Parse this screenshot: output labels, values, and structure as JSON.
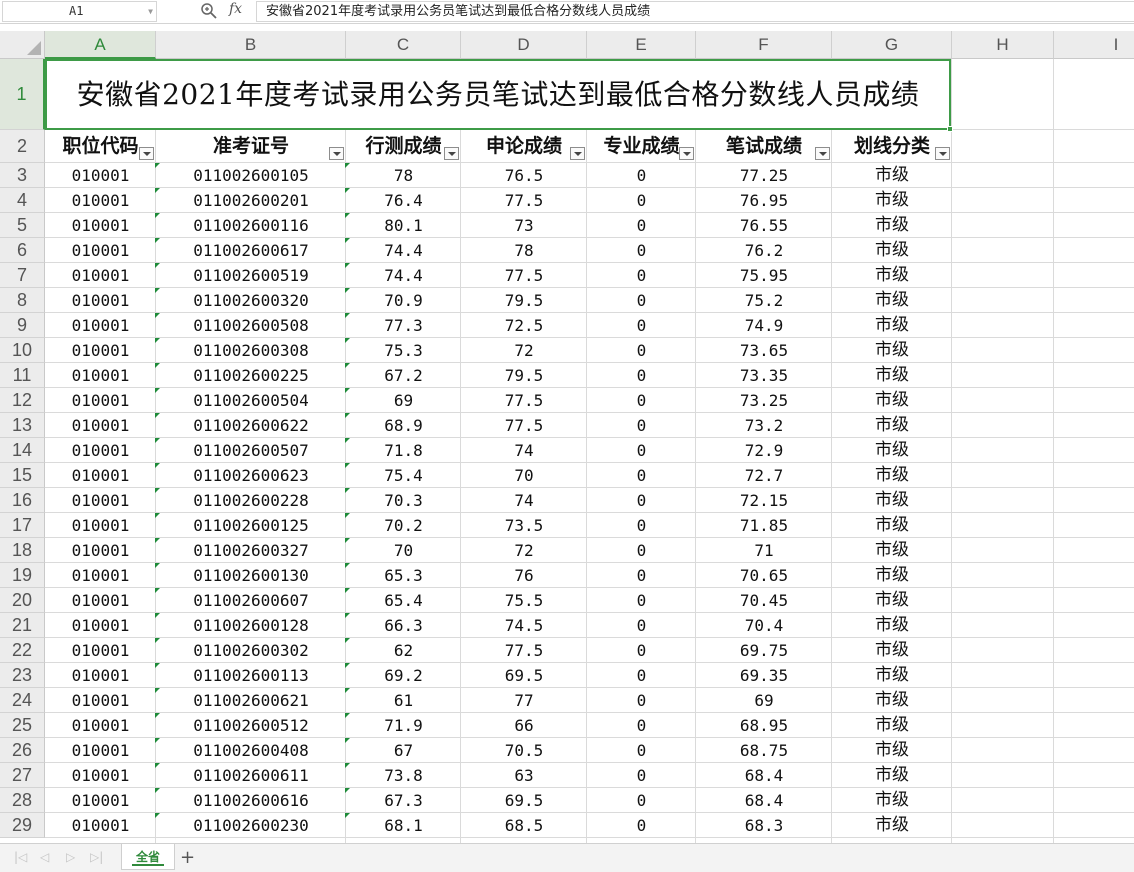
{
  "formula_bar": {
    "cell_ref": "A1",
    "fx_label": "fx",
    "formula": "安徽省2021年度考试录用公务员笔试达到最低合格分数线人员成绩"
  },
  "columns": [
    "A",
    "B",
    "C",
    "D",
    "E",
    "F",
    "G",
    "H",
    "I"
  ],
  "selected_column": "A",
  "selected_row": 1,
  "title": "安徽省2021年度考试录用公务员笔试达到最低合格分数线人员成绩",
  "headers": [
    "职位代码",
    "准考证号",
    "行测成绩",
    "申论成绩",
    "专业成绩",
    "笔试成绩",
    "划线分类"
  ],
  "rows": [
    [
      "010001",
      "011002600105",
      "78",
      "76.5",
      "0",
      "77.25",
      "市级"
    ],
    [
      "010001",
      "011002600201",
      "76.4",
      "77.5",
      "0",
      "76.95",
      "市级"
    ],
    [
      "010001",
      "011002600116",
      "80.1",
      "73",
      "0",
      "76.55",
      "市级"
    ],
    [
      "010001",
      "011002600617",
      "74.4",
      "78",
      "0",
      "76.2",
      "市级"
    ],
    [
      "010001",
      "011002600519",
      "74.4",
      "77.5",
      "0",
      "75.95",
      "市级"
    ],
    [
      "010001",
      "011002600320",
      "70.9",
      "79.5",
      "0",
      "75.2",
      "市级"
    ],
    [
      "010001",
      "011002600508",
      "77.3",
      "72.5",
      "0",
      "74.9",
      "市级"
    ],
    [
      "010001",
      "011002600308",
      "75.3",
      "72",
      "0",
      "73.65",
      "市级"
    ],
    [
      "010001",
      "011002600225",
      "67.2",
      "79.5",
      "0",
      "73.35",
      "市级"
    ],
    [
      "010001",
      "011002600504",
      "69",
      "77.5",
      "0",
      "73.25",
      "市级"
    ],
    [
      "010001",
      "011002600622",
      "68.9",
      "77.5",
      "0",
      "73.2",
      "市级"
    ],
    [
      "010001",
      "011002600507",
      "71.8",
      "74",
      "0",
      "72.9",
      "市级"
    ],
    [
      "010001",
      "011002600623",
      "75.4",
      "70",
      "0",
      "72.7",
      "市级"
    ],
    [
      "010001",
      "011002600228",
      "70.3",
      "74",
      "0",
      "72.15",
      "市级"
    ],
    [
      "010001",
      "011002600125",
      "70.2",
      "73.5",
      "0",
      "71.85",
      "市级"
    ],
    [
      "010001",
      "011002600327",
      "70",
      "72",
      "0",
      "71",
      "市级"
    ],
    [
      "010001",
      "011002600130",
      "65.3",
      "76",
      "0",
      "70.65",
      "市级"
    ],
    [
      "010001",
      "011002600607",
      "65.4",
      "75.5",
      "0",
      "70.45",
      "市级"
    ],
    [
      "010001",
      "011002600128",
      "66.3",
      "74.5",
      "0",
      "70.4",
      "市级"
    ],
    [
      "010001",
      "011002600302",
      "62",
      "77.5",
      "0",
      "69.75",
      "市级"
    ],
    [
      "010001",
      "011002600113",
      "69.2",
      "69.5",
      "0",
      "69.35",
      "市级"
    ],
    [
      "010001",
      "011002600621",
      "61",
      "77",
      "0",
      "69",
      "市级"
    ],
    [
      "010001",
      "011002600512",
      "71.9",
      "66",
      "0",
      "68.95",
      "市级"
    ],
    [
      "010001",
      "011002600408",
      "67",
      "70.5",
      "0",
      "68.75",
      "市级"
    ],
    [
      "010001",
      "011002600611",
      "73.8",
      "63",
      "0",
      "68.4",
      "市级"
    ],
    [
      "010001",
      "011002600616",
      "67.3",
      "69.5",
      "0",
      "68.4",
      "市级"
    ],
    [
      "010001",
      "011002600230",
      "68.1",
      "68.5",
      "0",
      "68.3",
      "市级"
    ]
  ],
  "sheet_tabs": [
    {
      "label": "全省",
      "active": true
    }
  ],
  "add_sheet_label": "+",
  "colors": {
    "accent_green": "#3e9b47",
    "header_bg": "#ececec",
    "grid_line": "#dadada"
  }
}
